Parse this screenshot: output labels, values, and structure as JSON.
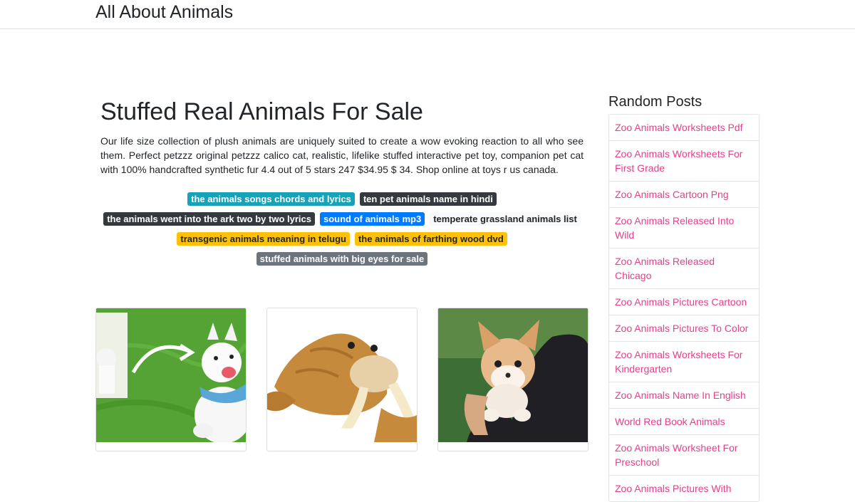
{
  "site": {
    "brand": "All About Animals"
  },
  "post": {
    "title": "Stuffed Real Animals For Sale",
    "description": "Our life size collection of plush animals are uniquely suited to create a wow evoking reaction to all who see them. Perfect petzzz original petzzz calico cat, realistic, lifelike stuffed interactive pet toy, companion pet cat with 100% handcrafted synthetic fur 4.4 out of 5 stars 247 $34.95 $ 34. Shop online at toys r us canada.",
    "tags": [
      {
        "label": "the animals songs chords and lyrics",
        "color": "#17a2b8"
      },
      {
        "label": "ten pet animals name in hindi",
        "color": "#343a40"
      },
      {
        "label": "the animals went into the ark two by two lyrics",
        "color": "#343a40"
      },
      {
        "label": "sound of animals mp3",
        "color": "#007bff"
      },
      {
        "label": "temperate grassland animals list",
        "color": "#f8f9fa"
      },
      {
        "label": "transgenic animals meaning in telugu",
        "color": "#ffc107"
      },
      {
        "label": "the animals of farthing wood dvd",
        "color": "#ffc107"
      },
      {
        "label": "stuffed animals with big eyes for sale",
        "color": "#6c757d"
      }
    ]
  },
  "cards": [
    {
      "image": "plush-white-dog-on-grass"
    },
    {
      "image": "plush-walrus"
    },
    {
      "image": "plush-fox-kitten-held"
    }
  ],
  "sidebar": {
    "title": "Random Posts",
    "link_color": "#e83e8c",
    "items": [
      "Zoo Animals Worksheets Pdf",
      "Zoo Animals Worksheets For First Grade",
      "Zoo Animals Cartoon Png",
      "Zoo Animals Released Into Wild",
      "Zoo Animals Released Chicago",
      "Zoo Animals Pictures Cartoon",
      "Zoo Animals Pictures To Color",
      "Zoo Animals Worksheets For Kindergarten",
      "Zoo Animals Name In English",
      "World Red Book Animals",
      "Zoo Animals Worksheet For Preschool",
      "Zoo Animals Pictures With"
    ]
  }
}
